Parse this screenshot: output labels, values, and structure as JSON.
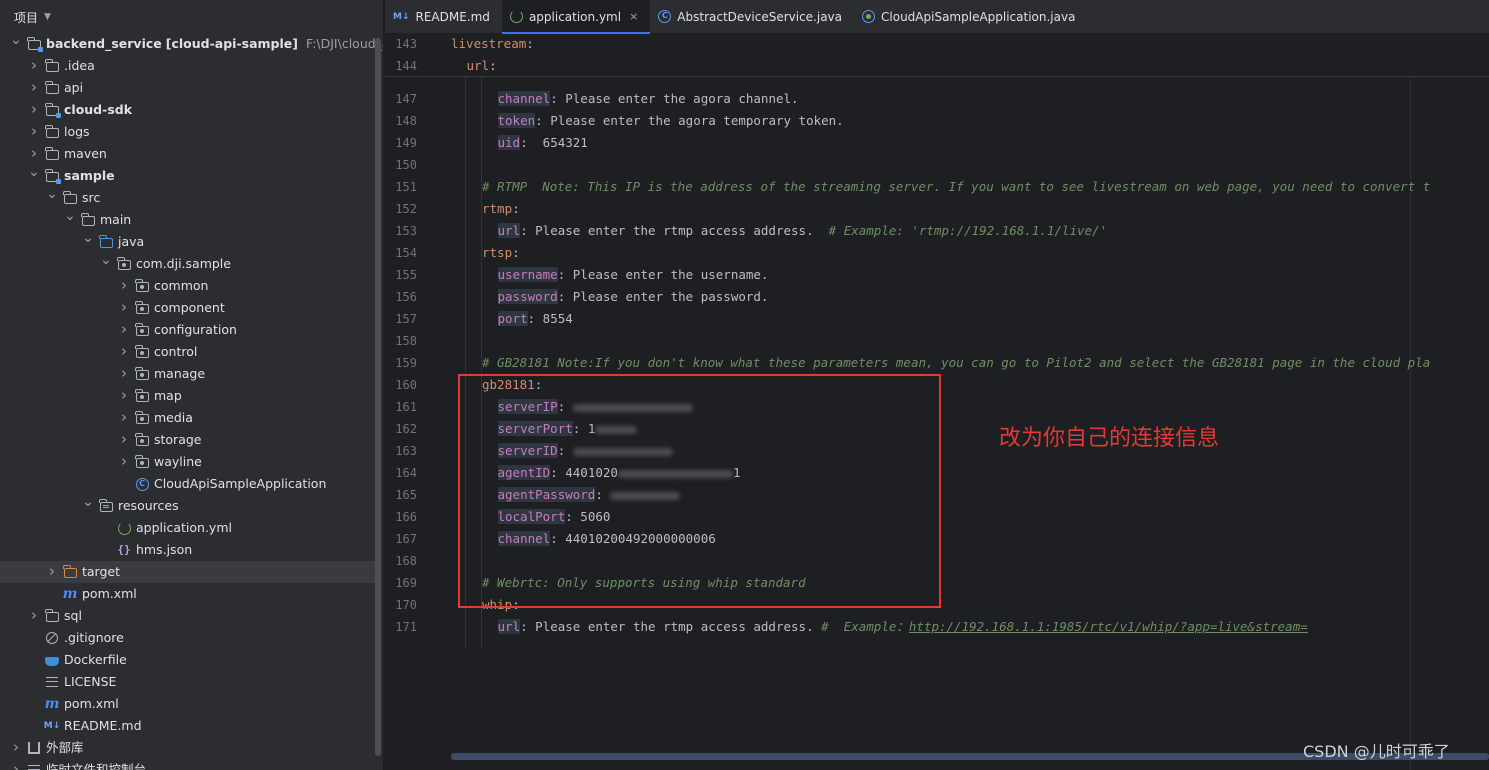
{
  "project_panel": {
    "title": "项目",
    "tree": [
      {
        "label": "backend_service",
        "suffix": "[cloud-api-sample]",
        "path": "F:\\DJI\\cloud_api_sa",
        "icon": "module-folder-icon",
        "indent": 0,
        "arrow": "down",
        "bold": true
      },
      {
        "label": ".idea",
        "icon": "folder-icon",
        "indent": 1,
        "arrow": "right"
      },
      {
        "label": "api",
        "icon": "folder-icon",
        "indent": 1,
        "arrow": "right"
      },
      {
        "label": "cloud-sdk",
        "icon": "module-folder-icon",
        "indent": 1,
        "arrow": "right",
        "bold": true
      },
      {
        "label": "logs",
        "icon": "folder-icon",
        "indent": 1,
        "arrow": "right"
      },
      {
        "label": "maven",
        "icon": "folder-icon",
        "indent": 1,
        "arrow": "right"
      },
      {
        "label": "sample",
        "icon": "module-folder-icon",
        "indent": 1,
        "arrow": "down",
        "bold": true
      },
      {
        "label": "src",
        "icon": "folder-icon",
        "indent": 2,
        "arrow": "down"
      },
      {
        "label": "main",
        "icon": "folder-icon",
        "indent": 3,
        "arrow": "down"
      },
      {
        "label": "java",
        "icon": "source-folder-icon",
        "indent": 4,
        "arrow": "down"
      },
      {
        "label": "com.dji.sample",
        "icon": "package-icon",
        "indent": 5,
        "arrow": "down"
      },
      {
        "label": "common",
        "icon": "package-icon",
        "indent": 6,
        "arrow": "right"
      },
      {
        "label": "component",
        "icon": "package-icon",
        "indent": 6,
        "arrow": "right"
      },
      {
        "label": "configuration",
        "icon": "package-icon",
        "indent": 6,
        "arrow": "right"
      },
      {
        "label": "control",
        "icon": "package-icon",
        "indent": 6,
        "arrow": "right"
      },
      {
        "label": "manage",
        "icon": "package-icon",
        "indent": 6,
        "arrow": "right"
      },
      {
        "label": "map",
        "icon": "package-icon",
        "indent": 6,
        "arrow": "right"
      },
      {
        "label": "media",
        "icon": "package-icon",
        "indent": 6,
        "arrow": "right"
      },
      {
        "label": "storage",
        "icon": "package-icon",
        "indent": 6,
        "arrow": "right"
      },
      {
        "label": "wayline",
        "icon": "package-icon",
        "indent": 6,
        "arrow": "right"
      },
      {
        "label": "CloudApiSampleApplication",
        "icon": "spring-class-icon",
        "indent": 6,
        "arrow": ""
      },
      {
        "label": "resources",
        "icon": "resources-folder-icon",
        "indent": 4,
        "arrow": "down"
      },
      {
        "label": "application.yml",
        "icon": "yaml-file-icon",
        "indent": 5,
        "arrow": ""
      },
      {
        "label": "hms.json",
        "icon": "json-file-icon",
        "indent": 5,
        "arrow": ""
      },
      {
        "label": "target",
        "icon": "excluded-folder-icon",
        "indent": 2,
        "arrow": "right",
        "selected": true
      },
      {
        "label": "pom.xml",
        "icon": "maven-file-icon",
        "indent": 2,
        "arrow": ""
      },
      {
        "label": "sql",
        "icon": "folder-icon",
        "indent": 1,
        "arrow": "right"
      },
      {
        "label": ".gitignore",
        "icon": "gitignore-file-icon",
        "indent": 1,
        "arrow": ""
      },
      {
        "label": "Dockerfile",
        "icon": "docker-file-icon",
        "indent": 1,
        "arrow": ""
      },
      {
        "label": "LICENSE",
        "icon": "text-file-icon",
        "indent": 1,
        "arrow": ""
      },
      {
        "label": "pom.xml",
        "icon": "maven-file-icon",
        "indent": 1,
        "arrow": ""
      },
      {
        "label": "README.md",
        "icon": "markdown-file-icon",
        "indent": 1,
        "arrow": ""
      },
      {
        "label": "外部库",
        "icon": "library-icon",
        "indent": 0,
        "arrow": "right"
      },
      {
        "label": "临时文件和控制台",
        "icon": "scratch-icon",
        "indent": 0,
        "arrow": "right"
      }
    ]
  },
  "tabs": [
    {
      "label": "README.md",
      "icon": "markdown-file-icon",
      "active": false
    },
    {
      "label": "application.yml",
      "icon": "yaml-file-icon",
      "active": true,
      "close": "×"
    },
    {
      "label": "AbstractDeviceService.java",
      "icon": "class-file-icon",
      "active": false
    },
    {
      "label": "CloudApiSampleApplication.java",
      "icon": "spring-class-icon",
      "active": false
    }
  ],
  "editor": {
    "sticky_lines": [
      {
        "no": "143",
        "indent": 0,
        "key": "livestream",
        "value": ""
      },
      {
        "no": "144",
        "indent": 1,
        "key": "url",
        "value": ""
      }
    ],
    "lines": [
      {
        "no": "147",
        "indent": 3,
        "key": "channel",
        "value": "Please enter the agora channel."
      },
      {
        "no": "148",
        "indent": 3,
        "key": "token",
        "value": "Please enter the agora temporary token."
      },
      {
        "no": "149",
        "indent": 3,
        "key": "uid",
        "value": " 654321"
      },
      {
        "no": "150",
        "indent": 0,
        "key": "",
        "value": ""
      },
      {
        "no": "151",
        "indent": 2,
        "comment": "# RTMP  Note: This IP is the address of the streaming server. If you want to see livestream on web page, you need to convert t"
      },
      {
        "no": "152",
        "indent": 2,
        "key": "rtmp",
        "value": ""
      },
      {
        "no": "153",
        "indent": 3,
        "key": "url",
        "value": "Please enter the rtmp access address.  ",
        "comment": "# Example: 'rtmp://192.168.1.1/live/'"
      },
      {
        "no": "154",
        "indent": 2,
        "key": "rtsp",
        "value": ""
      },
      {
        "no": "155",
        "indent": 3,
        "key": "username",
        "value": "Please enter the username."
      },
      {
        "no": "156",
        "indent": 3,
        "key": "password",
        "value": "Please enter the password."
      },
      {
        "no": "157",
        "indent": 3,
        "key": "port",
        "value": "8554"
      },
      {
        "no": "158",
        "indent": 0,
        "key": "",
        "value": ""
      },
      {
        "no": "159",
        "indent": 2,
        "comment": "# GB28181 Note:If you don't know what these parameters mean, you can go to Pilot2 and select the GB28181 page in the cloud pla"
      },
      {
        "no": "160",
        "indent": 2,
        "key": "gb28181",
        "value": ""
      },
      {
        "no": "161",
        "indent": 3,
        "key": "serverIP",
        "value": "",
        "redacted": 120
      },
      {
        "no": "162",
        "indent": 3,
        "key": "serverPort",
        "value": "1",
        "redacted": 42
      },
      {
        "no": "163",
        "indent": 3,
        "key": "serverID",
        "value": "",
        "redacted": 100
      },
      {
        "no": "164",
        "indent": 3,
        "key": "agentID",
        "value": "4401020",
        "redacted": 115,
        "tail": "1"
      },
      {
        "no": "165",
        "indent": 3,
        "key": "agentPassword",
        "value": "",
        "redacted": 70
      },
      {
        "no": "166",
        "indent": 3,
        "key": "localPort",
        "value": "5060"
      },
      {
        "no": "167",
        "indent": 3,
        "key": "channel",
        "value": "44010200492000000006"
      },
      {
        "no": "168",
        "indent": 0,
        "key": "",
        "value": ""
      },
      {
        "no": "169",
        "indent": 2,
        "comment": "# Webrtc: Only supports using whip standard"
      },
      {
        "no": "170",
        "indent": 2,
        "key": "whip",
        "value": ""
      },
      {
        "no": "171",
        "indent": 3,
        "key": "url",
        "value": "Please enter the rtmp access address. ",
        "comment": "#  Example：",
        "link": "http://192.168.1.1:1985/rtc/v1/whip/?app=live&stream="
      }
    ]
  },
  "annotation_text": "改为你自己的连接信息",
  "watermark": "CSDN @儿时可乖了",
  "colors": {
    "annotation": "#e53935",
    "key": "#c77dbb",
    "comment": "#6f8e63",
    "accent": "#3574f0"
  }
}
